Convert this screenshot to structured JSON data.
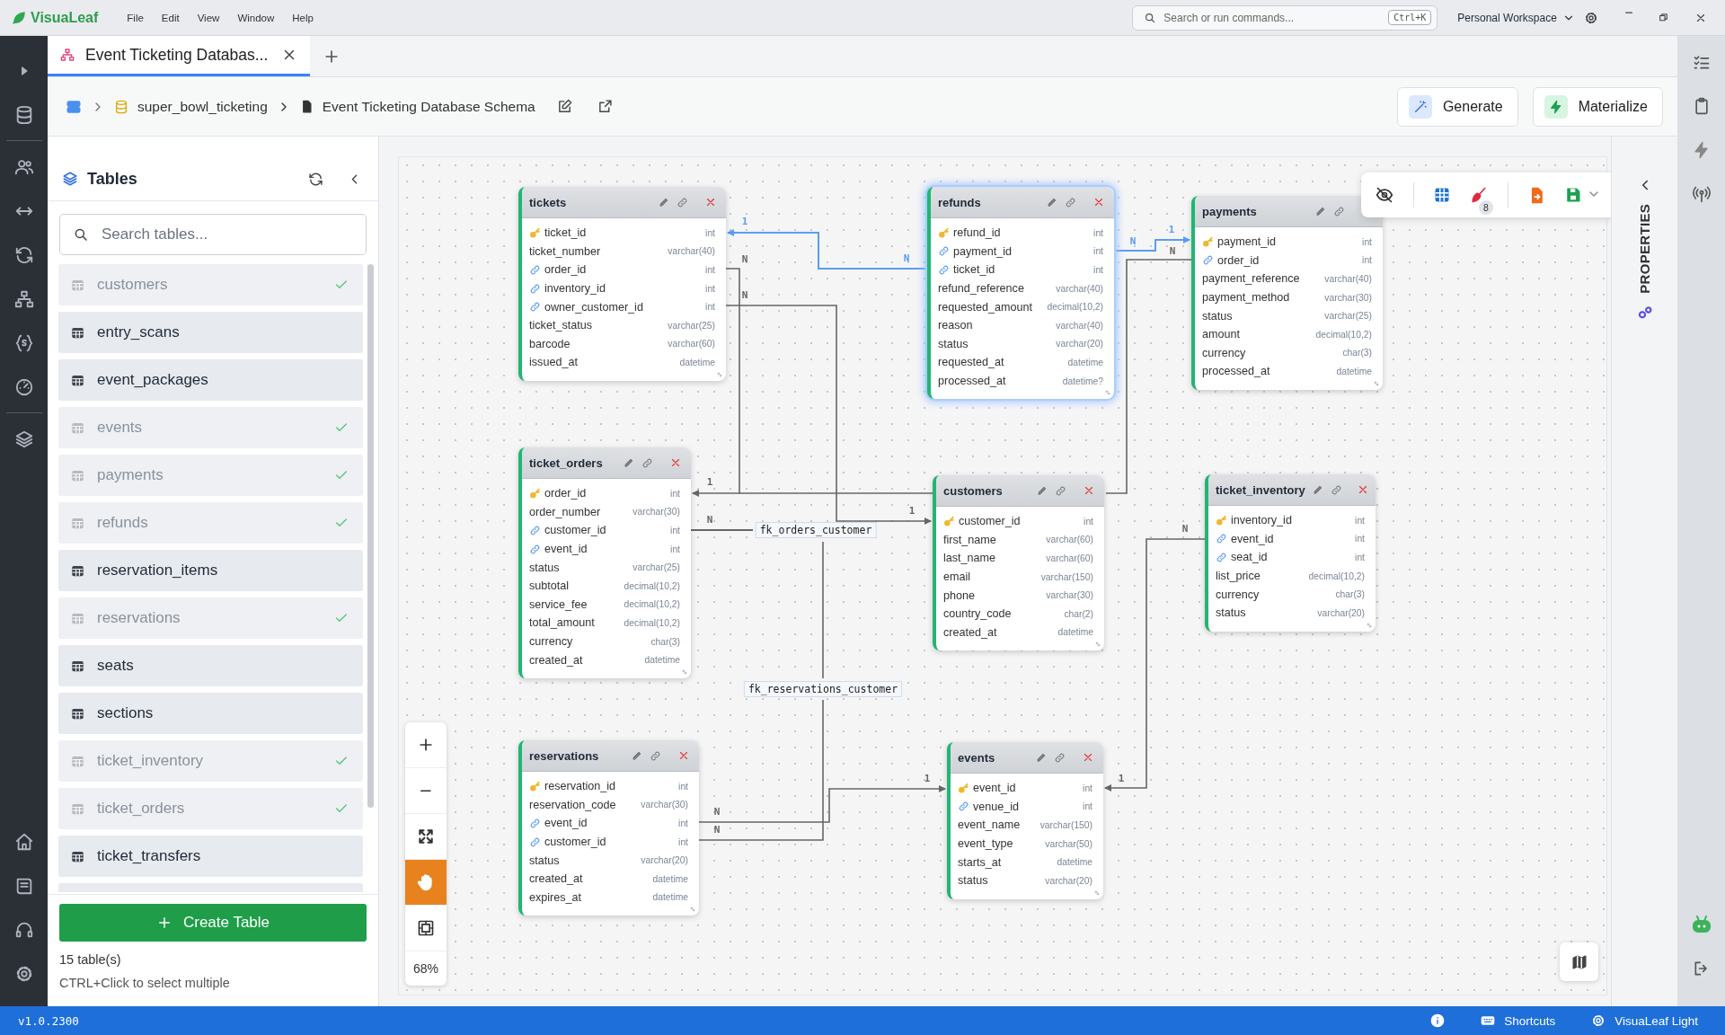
{
  "app": {
    "name": "VisuaLeaf",
    "menu": [
      "File",
      "Edit",
      "View",
      "Window",
      "Help"
    ],
    "search_placeholder": "Search or run commands...",
    "shortcut": "Ctrl+K",
    "workspace": "Personal Workspace"
  },
  "tabs": [
    {
      "label": "Event Ticketing Databas...",
      "selected": true
    }
  ],
  "breadcrumb": {
    "database": "super_bowl_ticketing",
    "diagram": "Event Ticketing Database Schema"
  },
  "actions": [
    "Generate",
    "Materialize"
  ],
  "tables_panel": {
    "title": "Tables",
    "search_placeholder": "Search tables...",
    "items": [
      {
        "name": "customers",
        "on_canvas": true
      },
      {
        "name": "entry_scans",
        "on_canvas": false
      },
      {
        "name": "event_packages",
        "on_canvas": false
      },
      {
        "name": "events",
        "on_canvas": true
      },
      {
        "name": "payments",
        "on_canvas": true
      },
      {
        "name": "refunds",
        "on_canvas": true
      },
      {
        "name": "reservation_items",
        "on_canvas": false
      },
      {
        "name": "reservations",
        "on_canvas": true
      },
      {
        "name": "seats",
        "on_canvas": false
      },
      {
        "name": "sections",
        "on_canvas": false
      },
      {
        "name": "ticket_inventory",
        "on_canvas": true
      },
      {
        "name": "ticket_orders",
        "on_canvas": true
      },
      {
        "name": "ticket_transfers",
        "on_canvas": false
      }
    ],
    "create_button": "Create Table",
    "count": "15 table(s)",
    "hint": "CTRL+Click to select multiple"
  },
  "canvas": {
    "tables": [
      {
        "name": "tickets",
        "selected": false,
        "columns": [
          {
            "name": "ticket_id",
            "type": "int",
            "kind": "primary_key"
          },
          {
            "name": "ticket_number",
            "type": "varchar(40)",
            "kind": "plain"
          },
          {
            "name": "order_id",
            "type": "int",
            "kind": "foreign_key"
          },
          {
            "name": "inventory_id",
            "type": "int",
            "kind": "foreign_key"
          },
          {
            "name": "owner_customer_id",
            "type": "int",
            "kind": "foreign_key"
          },
          {
            "name": "ticket_status",
            "type": "varchar(25)",
            "kind": "plain"
          },
          {
            "name": "barcode",
            "type": "varchar(60)",
            "kind": "plain"
          },
          {
            "name": "issued_at",
            "type": "datetime",
            "kind": "plain"
          }
        ]
      },
      {
        "name": "refunds",
        "selected": true,
        "columns": [
          {
            "name": "refund_id",
            "type": "int",
            "kind": "primary_key"
          },
          {
            "name": "payment_id",
            "type": "int",
            "kind": "foreign_key"
          },
          {
            "name": "ticket_id",
            "type": "int",
            "kind": "foreign_key"
          },
          {
            "name": "refund_reference",
            "type": "varchar(40)",
            "kind": "plain"
          },
          {
            "name": "requested_amount",
            "type": "decimal(10,2)",
            "kind": "plain"
          },
          {
            "name": "reason",
            "type": "varchar(40)",
            "kind": "plain"
          },
          {
            "name": "status",
            "type": "varchar(20)",
            "kind": "plain"
          },
          {
            "name": "requested_at",
            "type": "datetime",
            "kind": "plain"
          },
          {
            "name": "processed_at",
            "type": "datetime?",
            "kind": "plain"
          }
        ]
      },
      {
        "name": "payments",
        "selected": false,
        "columns": [
          {
            "name": "payment_id",
            "type": "int",
            "kind": "primary_key"
          },
          {
            "name": "order_id",
            "type": "int",
            "kind": "foreign_key"
          },
          {
            "name": "payment_reference",
            "type": "varchar(40)",
            "kind": "plain"
          },
          {
            "name": "payment_method",
            "type": "varchar(30)",
            "kind": "plain"
          },
          {
            "name": "status",
            "type": "varchar(25)",
            "kind": "plain"
          },
          {
            "name": "amount",
            "type": "decimal(10,2)",
            "kind": "plain"
          },
          {
            "name": "currency",
            "type": "char(3)",
            "kind": "plain"
          },
          {
            "name": "processed_at",
            "type": "datetime",
            "kind": "plain"
          }
        ]
      },
      {
        "name": "ticket_orders",
        "selected": false,
        "columns": [
          {
            "name": "order_id",
            "type": "int",
            "kind": "primary_key"
          },
          {
            "name": "order_number",
            "type": "varchar(30)",
            "kind": "plain"
          },
          {
            "name": "customer_id",
            "type": "int",
            "kind": "foreign_key"
          },
          {
            "name": "event_id",
            "type": "int",
            "kind": "foreign_key"
          },
          {
            "name": "status",
            "type": "varchar(25)",
            "kind": "plain"
          },
          {
            "name": "subtotal",
            "type": "decimal(10,2)",
            "kind": "plain"
          },
          {
            "name": "service_fee",
            "type": "decimal(10,2)",
            "kind": "plain"
          },
          {
            "name": "total_amount",
            "type": "decimal(10,2)",
            "kind": "plain"
          },
          {
            "name": "currency",
            "type": "char(3)",
            "kind": "plain"
          },
          {
            "name": "created_at",
            "type": "datetime",
            "kind": "plain"
          }
        ]
      },
      {
        "name": "customers",
        "selected": false,
        "columns": [
          {
            "name": "customer_id",
            "type": "int",
            "kind": "primary_key"
          },
          {
            "name": "first_name",
            "type": "varchar(60)",
            "kind": "plain"
          },
          {
            "name": "last_name",
            "type": "varchar(60)",
            "kind": "plain"
          },
          {
            "name": "email",
            "type": "varchar(150)",
            "kind": "plain"
          },
          {
            "name": "phone",
            "type": "varchar(30)",
            "kind": "plain"
          },
          {
            "name": "country_code",
            "type": "char(2)",
            "kind": "plain"
          },
          {
            "name": "created_at",
            "type": "datetime",
            "kind": "plain"
          }
        ]
      },
      {
        "name": "ticket_inventory",
        "selected": false,
        "columns": [
          {
            "name": "inventory_id",
            "type": "int",
            "kind": "primary_key"
          },
          {
            "name": "event_id",
            "type": "int",
            "kind": "foreign_key"
          },
          {
            "name": "seat_id",
            "type": "int",
            "kind": "foreign_key"
          },
          {
            "name": "list_price",
            "type": "decimal(10,2)",
            "kind": "plain"
          },
          {
            "name": "currency",
            "type": "char(3)",
            "kind": "plain"
          },
          {
            "name": "status",
            "type": "varchar(20)",
            "kind": "plain"
          }
        ]
      },
      {
        "name": "reservations",
        "selected": false,
        "columns": [
          {
            "name": "reservation_id",
            "type": "int",
            "kind": "primary_key"
          },
          {
            "name": "reservation_code",
            "type": "varchar(30)",
            "kind": "plain"
          },
          {
            "name": "event_id",
            "type": "int",
            "kind": "foreign_key"
          },
          {
            "name": "customer_id",
            "type": "int",
            "kind": "foreign_key"
          },
          {
            "name": "status",
            "type": "varchar(20)",
            "kind": "plain"
          },
          {
            "name": "created_at",
            "type": "datetime",
            "kind": "plain"
          },
          {
            "name": "expires_at",
            "type": "datetime",
            "kind": "plain"
          }
        ]
      },
      {
        "name": "events",
        "selected": false,
        "columns": [
          {
            "name": "event_id",
            "type": "int",
            "kind": "primary_key"
          },
          {
            "name": "venue_id",
            "type": "int",
            "kind": "foreign_key"
          },
          {
            "name": "event_name",
            "type": "varchar(150)",
            "kind": "plain"
          },
          {
            "name": "event_type",
            "type": "varchar(50)",
            "kind": "plain"
          },
          {
            "name": "starts_at",
            "type": "datetime",
            "kind": "plain"
          },
          {
            "name": "status",
            "type": "varchar(20)",
            "kind": "plain"
          }
        ]
      }
    ],
    "relationships": [
      {
        "from_label": "N",
        "to_label": "1",
        "highlighted": true
      },
      {
        "from_label": "N",
        "to_label": "1",
        "highlighted": true
      },
      {
        "from_label": "N",
        "highlighted": false
      },
      {
        "from_label": "N",
        "to_label": "1",
        "highlighted": false
      },
      {
        "from_label": "N",
        "to_label": "1",
        "highlighted": false
      },
      {
        "from_label": "N",
        "name": "fk_orders_customer",
        "highlighted": false
      },
      {
        "from_label": "N",
        "name": "fk_reservations_customer",
        "highlighted": false
      },
      {
        "from_label": "N",
        "to_label": "1",
        "highlighted": false
      },
      {
        "from_label": "N",
        "to_label": "1",
        "highlighted": false
      }
    ],
    "toolbar": {
      "badge": "8"
    },
    "zoom_tools": [
      {
        "kind": "zoom_in",
        "selected": false
      },
      {
        "kind": "zoom_out",
        "selected": false
      },
      {
        "kind": "fit",
        "selected": false
      },
      {
        "kind": "pan",
        "selected": true
      },
      {
        "kind": "frame",
        "selected": false
      }
    ],
    "zoom": "68%"
  },
  "properties_panel": {
    "title": "PROPERTIES"
  },
  "status_bar": {
    "version": "v1.0.2300",
    "items": [
      "Shortcuts",
      "VisuaLeaf Light"
    ]
  }
}
